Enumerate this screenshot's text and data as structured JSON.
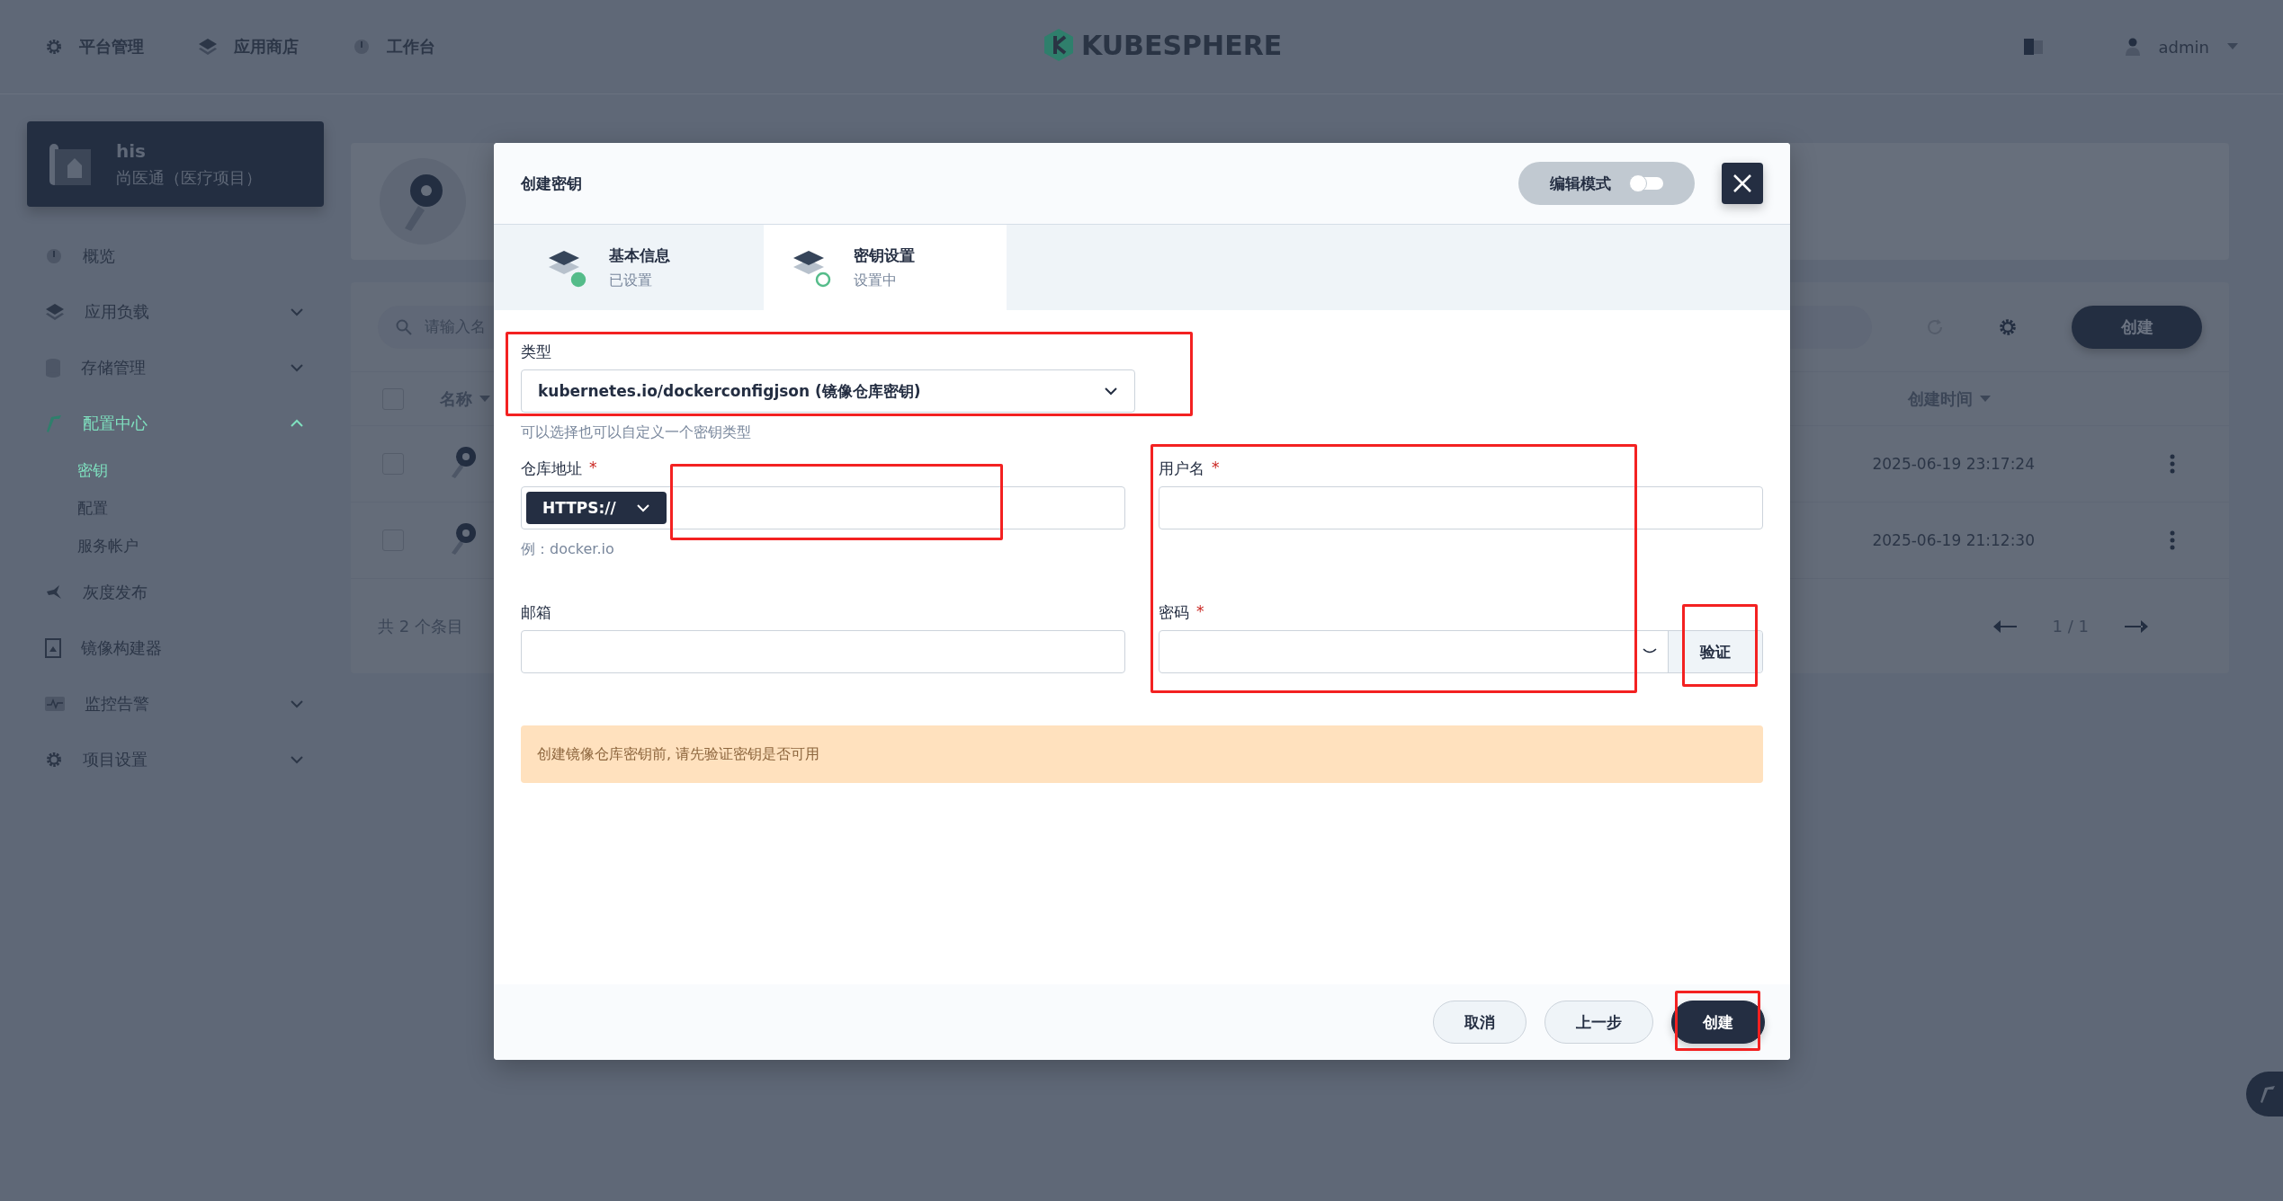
{
  "top_nav": {
    "items": [
      {
        "label": "平台管理"
      },
      {
        "label": "应用商店"
      },
      {
        "label": "工作台"
      }
    ],
    "logo": "KUBESPHERE",
    "user": "admin"
  },
  "project": {
    "name": "his",
    "description": "尚医通（医疗项目）"
  },
  "sidebar": {
    "items": [
      {
        "label": "概览",
        "kind": "link",
        "selected": false
      },
      {
        "label": "应用负载",
        "kind": "group",
        "selected": false,
        "expanded": false
      },
      {
        "label": "存储管理",
        "kind": "group",
        "selected": false,
        "expanded": false
      },
      {
        "label": "配置中心",
        "kind": "group",
        "selected": true,
        "expanded": true,
        "children": [
          {
            "label": "密钥",
            "selected": true
          },
          {
            "label": "配置",
            "selected": false
          },
          {
            "label": "服务帐户",
            "selected": false
          }
        ]
      },
      {
        "label": "灰度发布",
        "kind": "link",
        "selected": false
      },
      {
        "label": "镜像构建器",
        "kind": "link",
        "selected": false
      },
      {
        "label": "监控告警",
        "kind": "group",
        "selected": false,
        "expanded": false
      },
      {
        "label": "项目设置",
        "kind": "group",
        "selected": false,
        "expanded": false
      }
    ]
  },
  "toolbar": {
    "search_placeholder": "请输入名",
    "create_button": "创建"
  },
  "table": {
    "select_all_checked": false,
    "columns": [
      "名称",
      "创建时间"
    ],
    "rows": [
      {
        "checked": false,
        "created": "2025-06-19 23:17:24"
      },
      {
        "checked": false,
        "created": "2025-06-19 21:12:30"
      }
    ],
    "total": "共 2 个条目",
    "pagination": "1 / 1"
  },
  "dialog": {
    "title": "创建密钥",
    "edit_mode": {
      "label": "编辑模式",
      "on": false
    },
    "steps": [
      {
        "title": "基本信息",
        "status": "已设置",
        "done": true,
        "selected": false
      },
      {
        "title": "密钥设置",
        "status": "设置中",
        "done": false,
        "selected": true
      }
    ],
    "form": {
      "type": {
        "label": "类型",
        "value": "kubernetes.io/dockerconfigjson (镜像仓库密钥)",
        "hint": "可以选择也可以自定义一个密钥类型"
      },
      "registry": {
        "label": "仓库地址",
        "required_mark": "*",
        "protocol": "HTTPS://",
        "example": "例：docker.io"
      },
      "username": {
        "label": "用户名",
        "required_mark": "*"
      },
      "email": {
        "label": "邮箱"
      },
      "password": {
        "label": "密码",
        "required_mark": "*",
        "verify_button": "验证"
      },
      "alert": "创建镜像仓库密钥前, 请先验证密钥是否可用"
    },
    "buttons": [
      {
        "label": "取消",
        "primary": false
      },
      {
        "label": "上一步",
        "primary": false
      },
      {
        "label": "创建",
        "primary": true
      }
    ]
  }
}
